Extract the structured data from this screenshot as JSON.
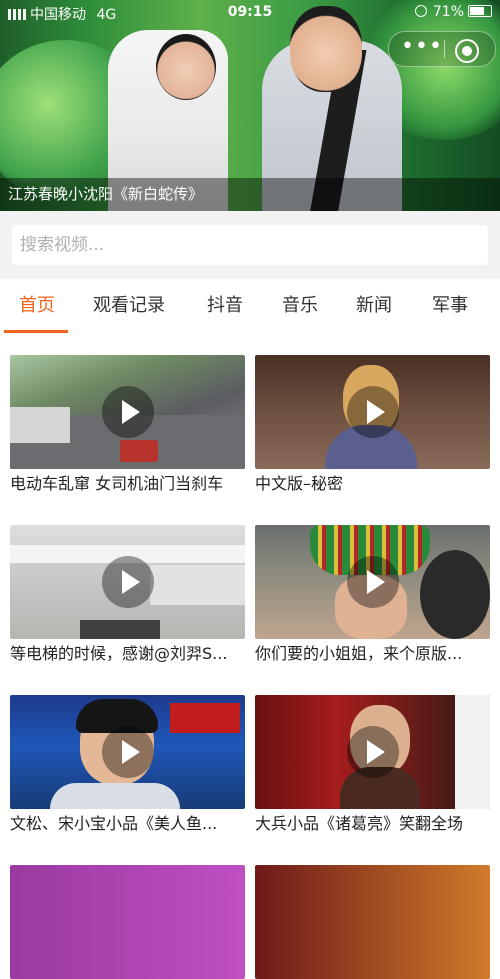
{
  "status_bar": {
    "carrier": "中国移动",
    "network": "4G",
    "time": "09:15",
    "battery": "71%"
  },
  "hero": {
    "caption": "江苏春晚小沈阳《新白蛇传》"
  },
  "search": {
    "placeholder": "搜索视频..."
  },
  "tabs": [
    {
      "label": "首页",
      "active": true
    },
    {
      "label": "观看记录",
      "active": false
    },
    {
      "label": "抖音",
      "active": false
    },
    {
      "label": "音乐",
      "active": false
    },
    {
      "label": "新闻",
      "active": false
    },
    {
      "label": "军事",
      "active": false
    }
  ],
  "videos": [
    {
      "title": "电动车乱窜 女司机油门当刹车"
    },
    {
      "title": "中文版–秘密"
    },
    {
      "title": "等电梯的时候，感谢@刘羿S..."
    },
    {
      "title": "你们要的小姐姐，来个原版..."
    },
    {
      "title": "文松、宋小宝小品《美人鱼..."
    },
    {
      "title": "大兵小品《诸葛亮》笑翻全场"
    }
  ],
  "colors": {
    "accent": "#f0641e"
  }
}
